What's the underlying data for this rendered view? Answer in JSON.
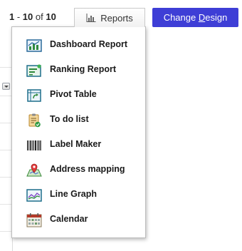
{
  "pager": {
    "range_start": "1",
    "separator": " - ",
    "range_end": "10",
    "of_text": " of ",
    "total": "10"
  },
  "toolbar": {
    "reports_label": "Reports",
    "change_design_prefix": "Change ",
    "change_design_underlined": "D",
    "change_design_suffix": "esign",
    "accent_color": "#3e3ed6"
  },
  "reports_menu": {
    "items": [
      {
        "label": "Dashboard Report",
        "icon": "dashboard-report-icon"
      },
      {
        "label": "Ranking Report",
        "icon": "ranking-report-icon"
      },
      {
        "label": "Pivot Table",
        "icon": "pivot-table-icon"
      },
      {
        "label": "To do list",
        "icon": "todo-list-icon"
      },
      {
        "label": "Label Maker",
        "icon": "barcode-icon"
      },
      {
        "label": "Address mapping",
        "icon": "map-icon"
      },
      {
        "label": "Line Graph",
        "icon": "line-graph-icon"
      },
      {
        "label": "Calendar",
        "icon": "calendar-icon"
      }
    ]
  }
}
